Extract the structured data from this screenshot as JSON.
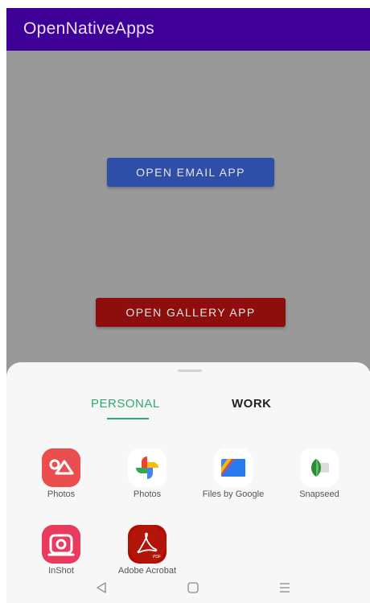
{
  "app_bar": {
    "title": "OpenNativeApps",
    "color": "#3e0096"
  },
  "buttons": {
    "email": {
      "label": "OPEN EMAIL APP",
      "color": "#2f4ea8"
    },
    "gallery": {
      "label": "OPEN GALLERY APP",
      "color": "#8e0e0e"
    }
  },
  "share_sheet": {
    "tabs": [
      {
        "label": "PERSONAL",
        "selected": true
      },
      {
        "label": "WORK",
        "selected": false
      }
    ],
    "apps": [
      {
        "label": "Photos",
        "icon": "photos-gallery-icon"
      },
      {
        "label": "Photos",
        "icon": "google-photos-icon"
      },
      {
        "label": "Files by Google",
        "icon": "files-by-google-icon"
      },
      {
        "label": "Snapseed",
        "icon": "snapseed-icon"
      },
      {
        "label": "InShot",
        "icon": "inshot-icon"
      },
      {
        "label": "Adobe Acrobat",
        "icon": "adobe-acrobat-icon"
      }
    ]
  },
  "navigation": [
    "back-icon",
    "home-icon",
    "recents-icon"
  ]
}
